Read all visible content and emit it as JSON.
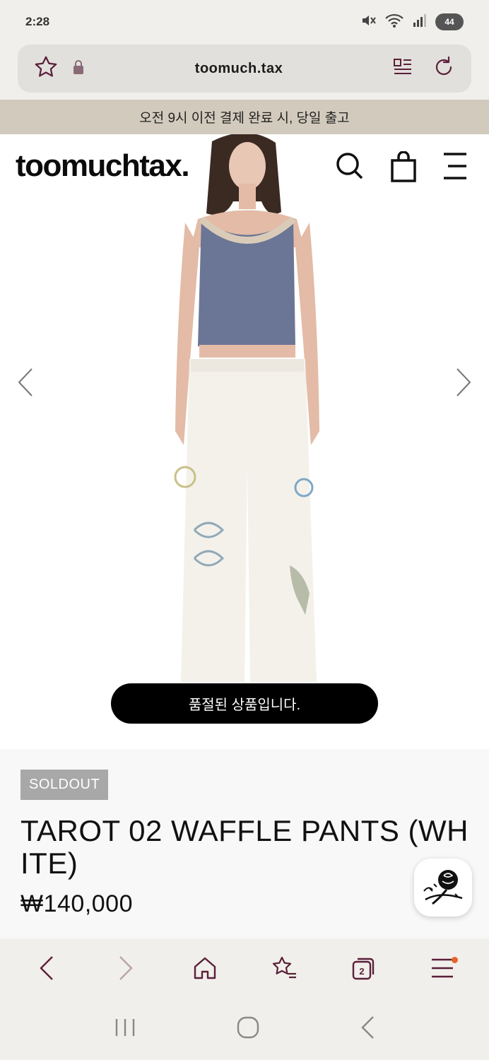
{
  "status": {
    "time": "2:28",
    "battery": "44"
  },
  "browser": {
    "url": "toomuch.tax"
  },
  "announcement": "오전 9시 이전 결제 완료 시, 당일 출고",
  "site": {
    "logo": "toomuchtax."
  },
  "product": {
    "soldout_toast": "품절된 상품입니다.",
    "badge": "SOLDOUT",
    "title": "TAROT 02 WAFFLE PANTS (WHITE)",
    "price": "₩140,000",
    "image_alt": "model wearing blue lace camisole and white waffle pants with tarot prints"
  },
  "bottom_nav": {
    "tabs_count": "2"
  },
  "colors": {
    "accent": "#5a1f3a",
    "announce_bg": "#d2cbbd",
    "toast_bg": "#000000",
    "notif": "#e8622a"
  }
}
